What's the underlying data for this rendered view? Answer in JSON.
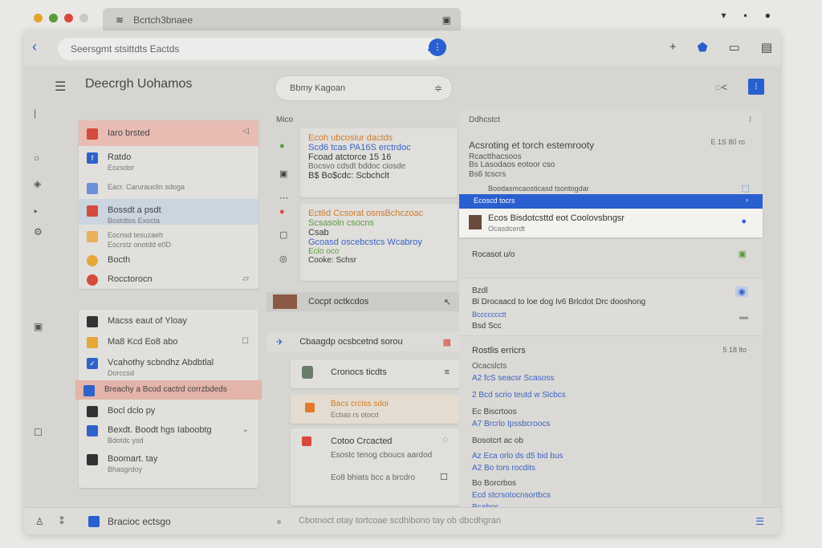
{
  "os": {
    "tab_title": "Bcrtch3bnaee",
    "colors": {
      "red": "#d9473d",
      "orange": "#e4a42a",
      "green": "#5a9a3c",
      "accent": "#2a5fd0"
    }
  },
  "toolbar": {
    "url": "Seersgmt stsittdts Eactds"
  },
  "app": {
    "title": "Deecrgh Uohamos",
    "search_placeholder": "Bbmy Kagoan"
  },
  "left_panel": {
    "group1": [
      {
        "label": "Iaro brsted",
        "sub": "",
        "icon_color": "#d24b3d"
      },
      {
        "label": "Ratdo",
        "sub": "Eozsdor",
        "icon_color": "#2f62c8"
      },
      {
        "label": "",
        "sub": "Eacr. Carurauclin sdoga",
        "icon_color": "#6b8fd9"
      },
      {
        "label": "Bossdt a psdt",
        "sub": "Bostdtos Exocta",
        "icon_color": "#d24b3d"
      },
      {
        "label": "Eocnsd tesuzaeh",
        "sub": "Eocrstz onotdd e0D",
        "icon_color": "#e6b15a"
      },
      {
        "label": "Bocth",
        "sub": "",
        "icon_color": "#e3a73a"
      },
      {
        "label": "Rocctorocn",
        "sub": "",
        "icon_color": "#d24b3d"
      }
    ],
    "group2": [
      {
        "label": "Macss eaut of Yloay",
        "sub": "",
        "icon_color": "#333333"
      },
      {
        "label": "Ma8 Kcd Eo8 abo",
        "sub": "",
        "icon_color": "#e3a73a"
      },
      {
        "label": "Vcahothy scbndhz Abdbtlal",
        "sub": "Dorccsd",
        "icon_color": "#2f62c8"
      },
      {
        "label": "Breachy a Bcod cactrd corrzbdeds",
        "sub": "",
        "icon_color": "#2f62c8"
      },
      {
        "label": "Bocl dclo py",
        "sub": "",
        "icon_color": "#333333"
      },
      {
        "label": "Bexdt. Boodt hgs Iaboobtg",
        "sub": "Bdotdc ysd",
        "icon_color": "#2f62c8"
      },
      {
        "label": "Boomart. tay",
        "sub": "Bhasgrdoy",
        "icon_color": "#333333"
      }
    ]
  },
  "middle": {
    "label": "Mico",
    "cards": [
      {
        "lines": [
          "Ecoh ubcosiur dactds",
          "Scd6 tcas PA16S erctrdoc",
          "Fcoad atctorce 15 16",
          "Bocsvo cdsdt bddoc ciosde",
          "B$ Bo$cdc: Scbchclt"
        ]
      },
      {
        "lines": [
          "Ect6d Ccsorat osnsBchczoac",
          "Scsasoln csocns",
          "Csab",
          "Gcoasd oscebcstcs Wcabroy",
          "Eclo oco",
          "Cooke: Schsr"
        ]
      }
    ],
    "bars": [
      "Cocpt octkcdos",
      "Cbaagdp ocsbcetnd sorou"
    ],
    "items": [
      {
        "title": "Cronocs ticdts",
        "sub": ""
      },
      {
        "title": "Bacs crciss sdoi",
        "sub": "Ecbas rs otocd"
      },
      {
        "title": "Cotoo Crcacted",
        "sub": "Esostc tenog cboucs aardod",
        "extra": "Eo8 bhiats bcc a brcdro"
      }
    ]
  },
  "right": {
    "header": "Ddhcstct",
    "header_right": "I",
    "title": "Acsroting et torch estemrooty",
    "time": "E 1S 80 ro",
    "sub1": "Rcactthacsoos",
    "sub2": "Bs Lasodaos eotoor cso",
    "sub3": "Bs6 tcscrs",
    "sub4": "Boodasmcaosticasd tsontogdar",
    "highlight": "Ecoscd tocrs",
    "selected_title": "Ecos Bisdotcsttd eot Coolovsbngsr",
    "selected_sub": "Ocasdcerdt",
    "row1": "Rocasot u/o",
    "block1_title": "Bzdl",
    "block1_body": "Bl Drocaacd to loe dog Iv6 Brlcdot Drc dooshong",
    "block1_link": "Bccccccctt",
    "block1_foot": "Bsd Scc",
    "block2_title": "Rostlis erricrs",
    "block2_time": "5 18 lto",
    "block2_lines": [
      "Ocacslcts",
      "A2 fcS seacsr Scasoss",
      "2 Bcd scrio teutd w Slcbcs",
      "Ec Biscrtoos",
      "A7 Brcrlo Ipssbcroocs",
      "Bosotcrt ac ob",
      "Az Eca orlo ds d5 bid bus",
      "A2 Bo tors rocdits",
      "Bo Borcrbos",
      "Ecd stcrsotocnsortbcs",
      "Bcabos"
    ]
  },
  "bottom": {
    "label": "Bracioc ectsgo",
    "status": "Cbotnoct otay tortcoae scdhibono tay ob dbcdhgran"
  }
}
